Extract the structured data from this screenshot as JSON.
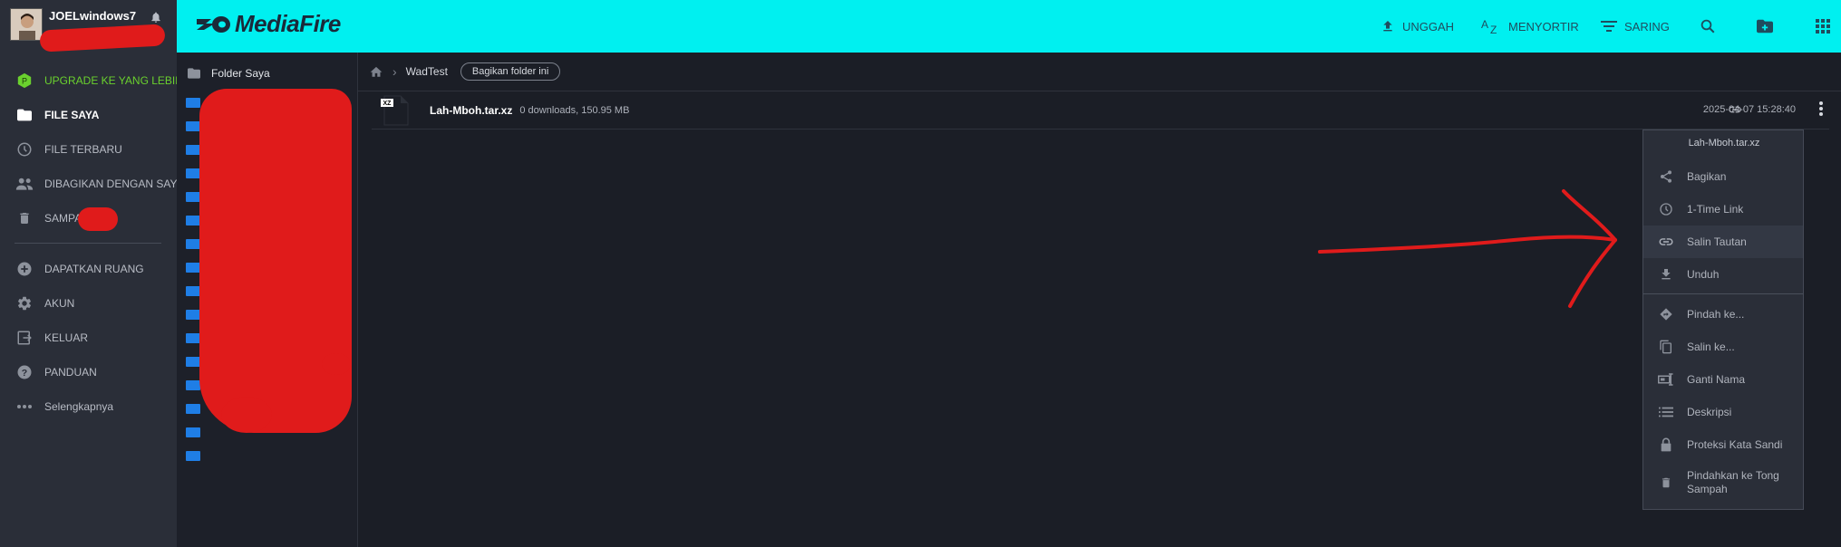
{
  "user": {
    "name": "JOELwindows7"
  },
  "sidebar": {
    "items": [
      {
        "label": "UPGRADE KE YANG LEBIH",
        "icon": "upgrade-badge-icon",
        "badge": "P"
      },
      {
        "label": "FILE SAYA",
        "icon": "folder-icon"
      },
      {
        "label": "FILE TERBARU",
        "icon": "clock-icon"
      },
      {
        "label": "DIBAGIKAN DENGAN SAY",
        "icon": "people-icon"
      },
      {
        "label": "SAMPA",
        "icon": "trash-icon"
      },
      {
        "label": "DAPATKAN RUANG",
        "icon": "plus-circle-icon"
      },
      {
        "label": "AKUN",
        "icon": "gear-icon"
      },
      {
        "label": "KELUAR",
        "icon": "logout-icon"
      },
      {
        "label": "PANDUAN",
        "icon": "help-icon"
      },
      {
        "label": "Selengkapnya",
        "icon": "more-horizontal-icon"
      }
    ]
  },
  "header": {
    "logo": "MediaFire",
    "upload_label": "UNGGAH",
    "sort_label": "MENYORTIR",
    "filter_label": "SARING",
    "accent_color": "#00f0f0"
  },
  "tree": {
    "root_label": "Folder Saya"
  },
  "breadcrumb": {
    "folder": "WadTest",
    "share_button": "Bagikan folder ini"
  },
  "file": {
    "type_badge": "XZ",
    "name": "Lah-Mboh.tar.xz",
    "meta": "0 downloads, 150.95 MB",
    "date": "2025-04-07 15:28:40"
  },
  "menu": {
    "title": "Lah-Mboh.tar.xz",
    "items": [
      {
        "label": "Bagikan",
        "icon": "share-icon"
      },
      {
        "label": "1-Time Link",
        "icon": "clock-icon"
      },
      {
        "label": "Salin Tautan",
        "icon": "link-icon",
        "highlighted": true
      },
      {
        "label": "Unduh",
        "icon": "download-icon"
      },
      {
        "label": "Pindah ke...",
        "icon": "move-icon"
      },
      {
        "label": "Salin ke...",
        "icon": "copy-icon"
      },
      {
        "label": "Ganti Nama",
        "icon": "rename-icon"
      },
      {
        "label": "Deskripsi",
        "icon": "list-icon"
      },
      {
        "label": "Proteksi Kata Sandi",
        "icon": "lock-icon"
      },
      {
        "label": "Pindahkan ke Tong Sampah",
        "icon": "trash-icon"
      }
    ]
  }
}
